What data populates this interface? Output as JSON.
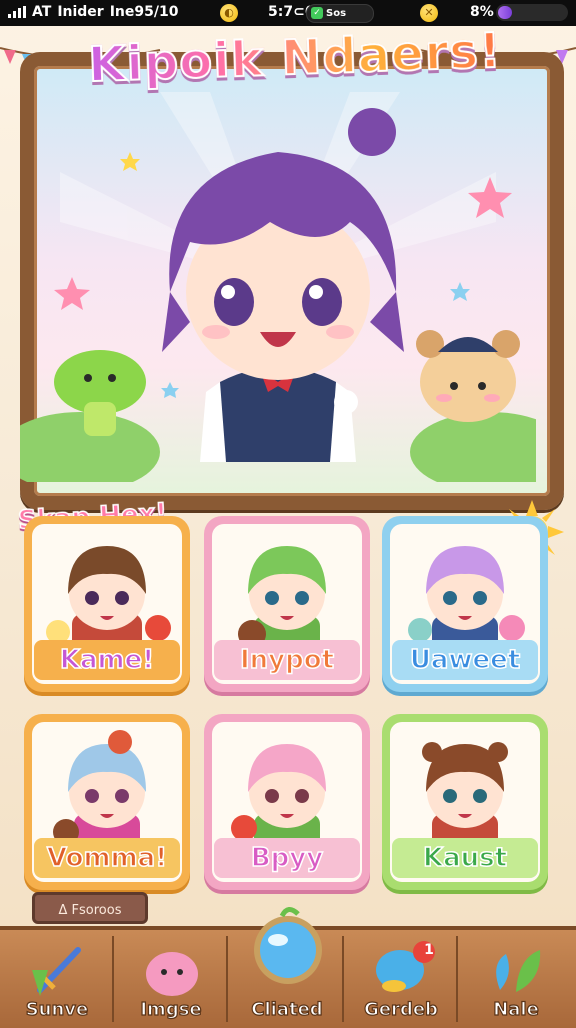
{
  "status_bar": {
    "carrier": "AT",
    "network": "Inider",
    "extra": "Ine95/10",
    "time": "5:7⊂6",
    "pill_text": "Sos",
    "battery_percent": "8%",
    "energy_fill": 0.2
  },
  "game_title": "Kipoik Ndaers!",
  "section_title": "Skap Hex!",
  "characters": [
    {
      "name": "Kame!",
      "hair": "#7a4a2a"
    },
    {
      "name": "Inypot",
      "hair": "#7cc85a"
    },
    {
      "name": "Uaweet",
      "hair": "#c898e8"
    },
    {
      "name": "Vomma!",
      "hair": "#9fc8e8"
    },
    {
      "name": "Bpyy",
      "hair": "#f5a6c8"
    },
    {
      "name": "Kaust",
      "hair": "#8a4a2a"
    }
  ],
  "mini_tag": "Δ Fsoroos",
  "nav": [
    {
      "label": "Sunve",
      "icon": "sword-icon"
    },
    {
      "label": "Imgse",
      "icon": "pink-slime-icon"
    },
    {
      "label": "Cliated",
      "icon": "crystal-orb-icon"
    },
    {
      "label": "Gerdeb",
      "icon": "chat-bubble-icon",
      "badge": "1"
    },
    {
      "label": "Nale",
      "icon": "leaf-icon"
    }
  ],
  "colors": {
    "frame_wood": "#8a5a34",
    "nav_wood": "#c98a56",
    "accent_pink": "#ff7aa8",
    "hero_hair": "#7b4aa8"
  }
}
